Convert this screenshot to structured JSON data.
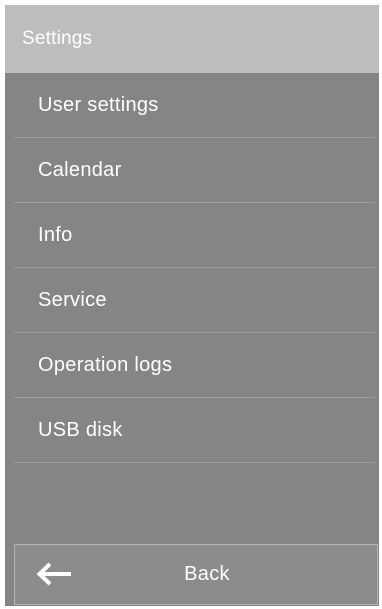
{
  "header": {
    "title": "Settings"
  },
  "menu": {
    "items": [
      {
        "label": "User settings"
      },
      {
        "label": "Calendar"
      },
      {
        "label": "Info"
      },
      {
        "label": "Service"
      },
      {
        "label": "Operation logs"
      },
      {
        "label": "USB disk"
      }
    ]
  },
  "footer": {
    "back_label": "Back",
    "back_icon": "arrow-left-icon"
  },
  "colors": {
    "panel_background": "#858585",
    "header_background": "#bdbdbd",
    "text": "#ffffff"
  }
}
